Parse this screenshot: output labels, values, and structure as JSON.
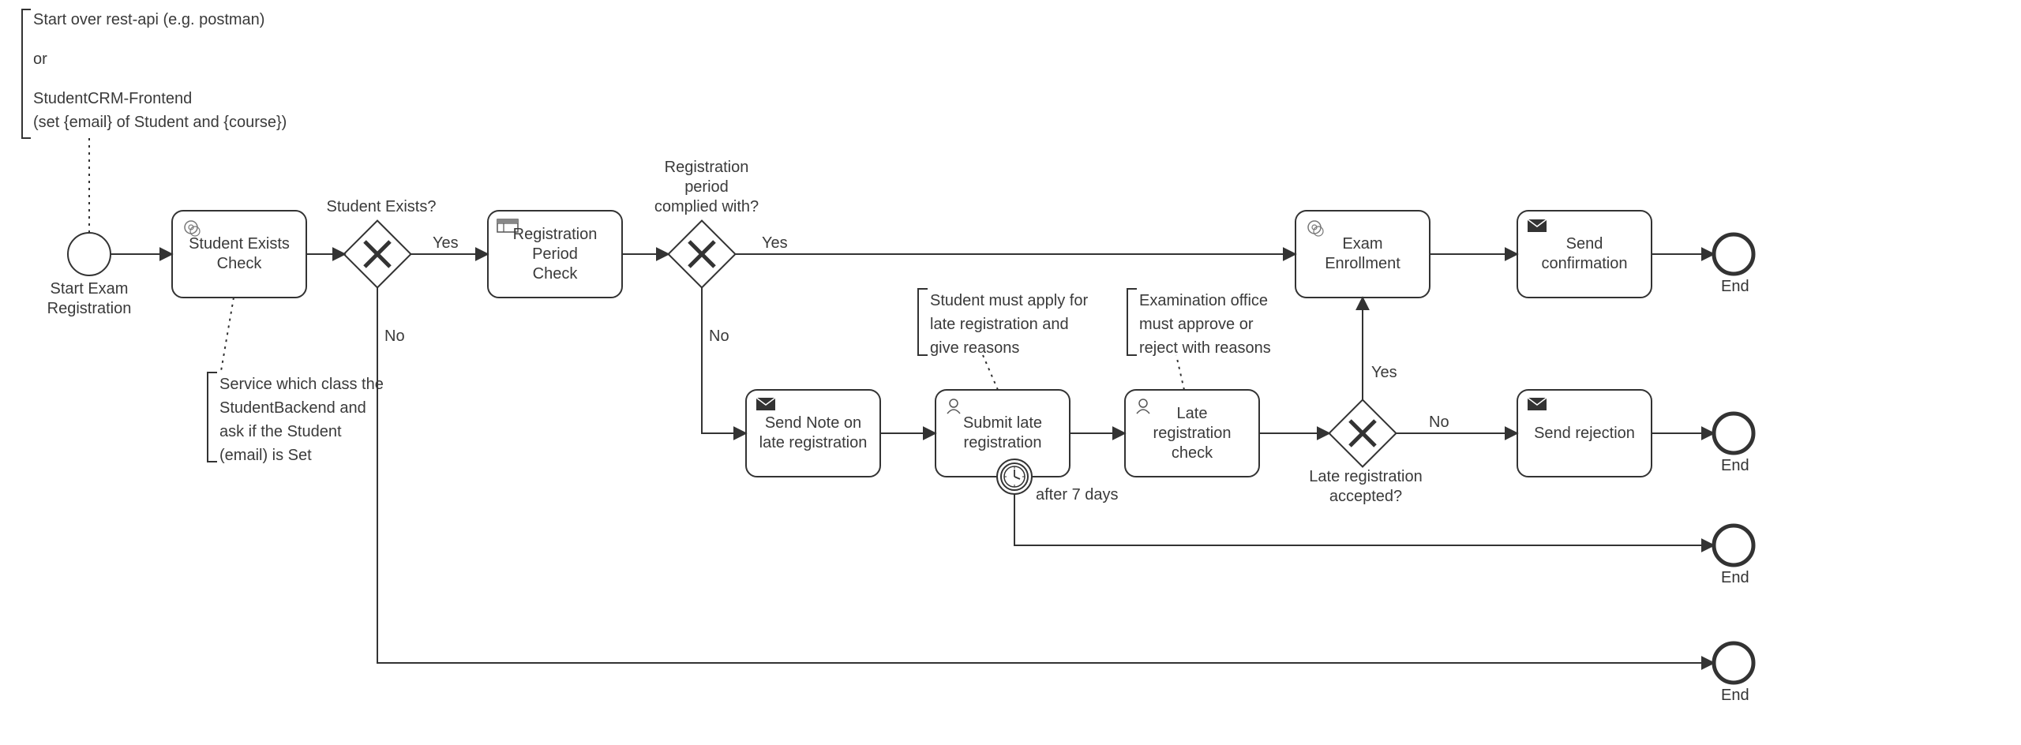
{
  "annotations": {
    "top_left": {
      "line1": "Start over rest-api (e.g. postman)",
      "line2": "or",
      "line3": "StudentCRM-Frontend",
      "line4": "(set {email} of Student and {course})"
    },
    "student_exists_service": "Service which class the\nStudentBackend and\nask if the Student\n(email) is Set",
    "submit_late_note": "Student must apply for\nlate registration and\ngive reasons",
    "late_check_note": "Examination office\nmust approve or\nreject with reasons"
  },
  "events": {
    "start_label": "Start Exam\nRegistration",
    "end1": "End",
    "end2": "End",
    "end3": "End",
    "end4": "End",
    "timer_label": "after 7 days"
  },
  "tasks": {
    "student_exists_check": "Student Exists\nCheck",
    "registration_period_check": "Registration\nPeriod\nCheck",
    "send_note_late": "Send Note on\nlate registration",
    "submit_late_registration": "Submit late\nregistration",
    "late_registration_check": "Late\nregistration\ncheck",
    "exam_enrollment": "Exam\nEnrollment",
    "send_confirmation": "Send\nconfirmation",
    "send_rejection": "Send rejection"
  },
  "gateways": {
    "student_exists": "Student Exists?",
    "registration_period": "Registration\nperiod\ncomplied with?",
    "late_accepted": "Late registration\naccepted?"
  },
  "edges": {
    "yes1": "Yes",
    "no1": "No",
    "yes2": "Yes",
    "no2": "No",
    "yes3": "Yes",
    "no3": "No"
  }
}
